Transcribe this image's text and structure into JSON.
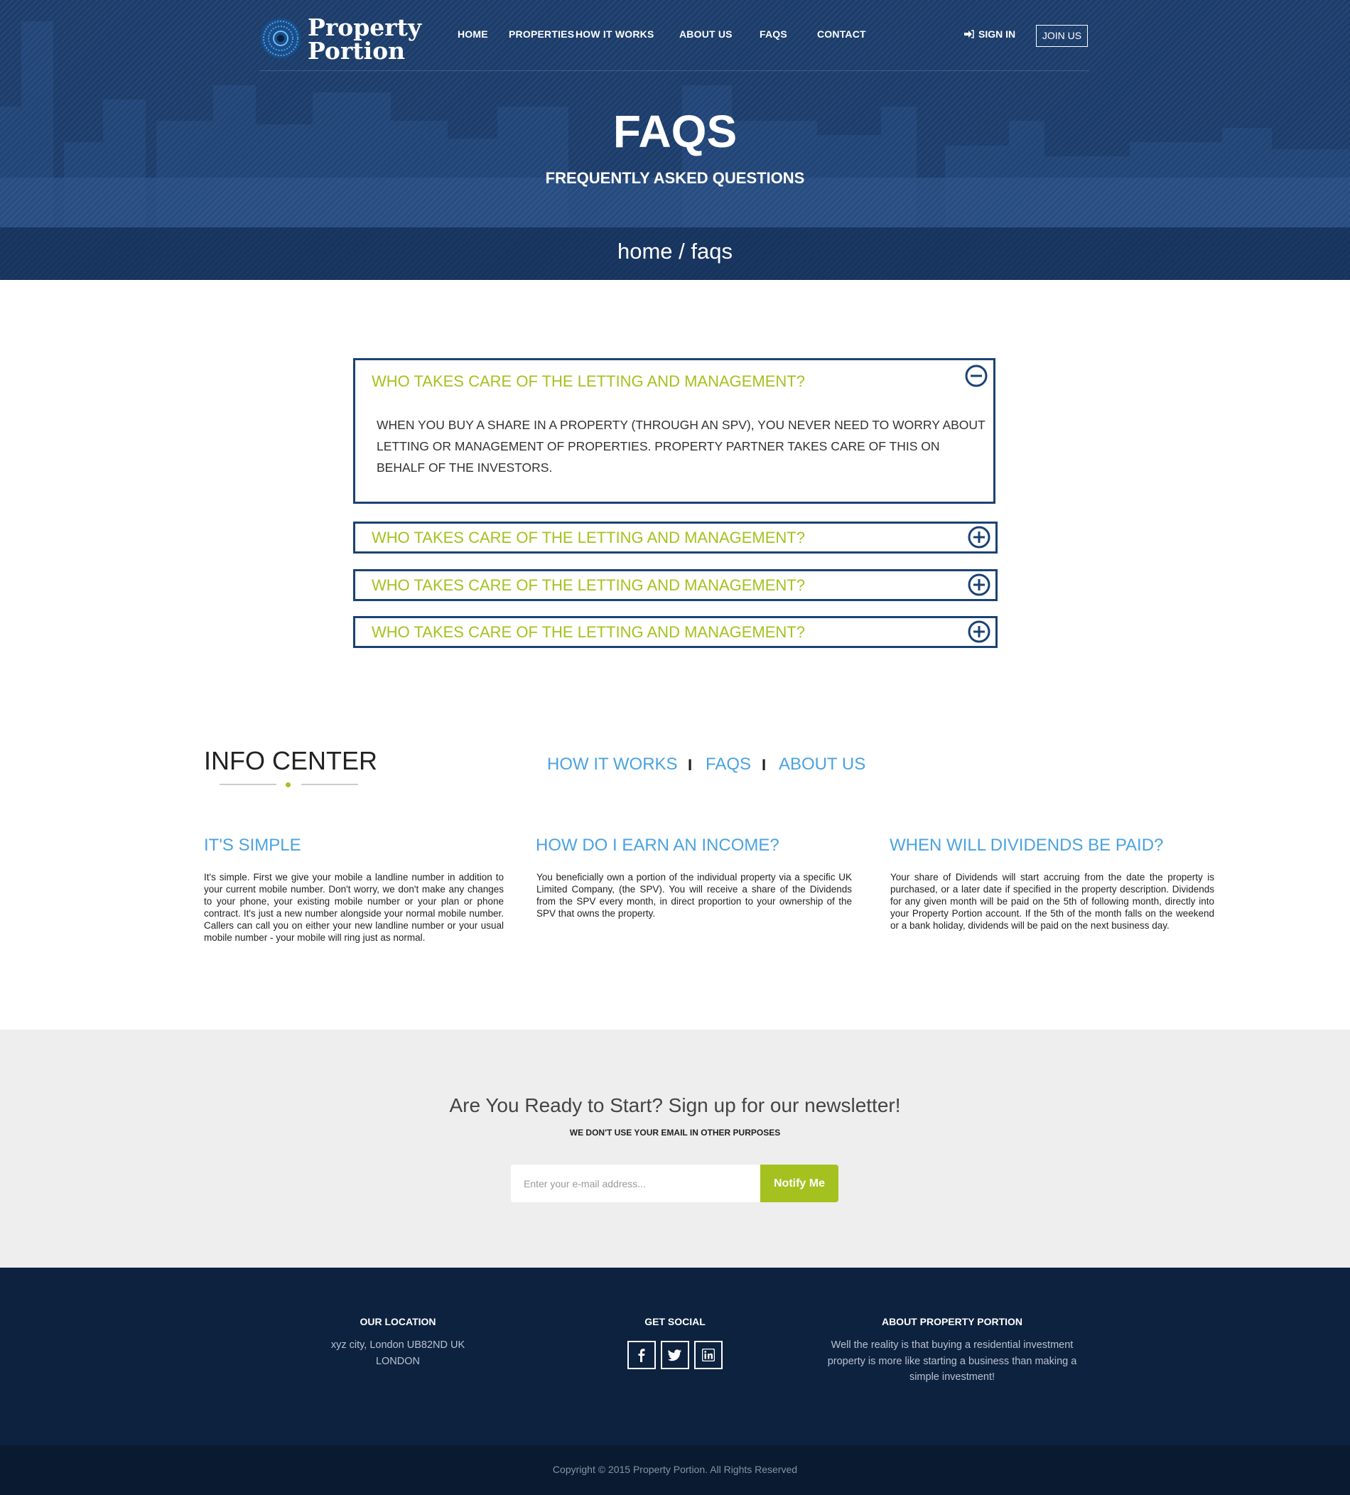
{
  "header": {
    "logo_line1": "Property",
    "logo_line2": "Portion",
    "nav": [
      "HOME",
      "PROPERTIES",
      "HOW IT WORKS",
      "ABOUT US",
      "FAQS",
      "CONTACT"
    ],
    "signin": "SIGN IN",
    "joinus": "JOIN US"
  },
  "hero": {
    "title": "FAQS",
    "subtitle": "FREQUENTLY ASKED QUESTIONS",
    "breadcrumb": "home / faqs"
  },
  "faqs": [
    {
      "question": "WHO TAKES CARE OF THE LETTING AND MANAGEMENT?",
      "answer": "WHEN YOU BUY A SHARE IN A PROPERTY (THROUGH AN SPV), YOU NEVER NEED TO WORRY ABOUT LETTING OR MANAGEMENT OF PROPERTIES. PROPERTY PARTNER TAKES CARE OF THIS ON BEHALF OF THE INVESTORS.",
      "expanded": true
    },
    {
      "question": "WHO TAKES CARE OF THE LETTING AND MANAGEMENT?",
      "expanded": false
    },
    {
      "question": "WHO TAKES CARE OF THE LETTING AND MANAGEMENT?",
      "expanded": false
    },
    {
      "question": "WHO TAKES CARE OF THE LETTING AND MANAGEMENT?",
      "expanded": false
    }
  ],
  "info_center": {
    "title": "INFO CENTER",
    "links": [
      "HOW IT WORKS",
      "FAQS",
      "ABOUT US"
    ],
    "separator": "I",
    "columns": [
      {
        "title": "IT'S SIMPLE",
        "text": "It's simple. First we give your mobile a landline number in addition to your current mobile number. Don't worry, we don't make any changes to your phone, your existing mobile number or your plan or phone contract. It's just a new number alongside your normal mobile number. Callers can call you on either your new landline number or your usual mobile number - your mobile will ring just as normal."
      },
      {
        "title": "HOW DO I EARN AN INCOME?",
        "text": "You beneficially own a portion of the individual property via a specific UK Limited Company, (the SPV). You will receive a share of the Dividends from the SPV every month, in direct proportion to your ownership of the SPV that owns the property."
      },
      {
        "title": "WHEN WILL DIVIDENDS BE PAID?",
        "text": "Your share of Dividends will start accruing from the date the property is purchased, or a later date if specified in the property description. Dividends for any given month will be paid on the 5th of following month, directly into your Property Portion account. If the 5th of the month falls on the weekend or a bank holiday, dividends will be paid on the next business day."
      }
    ]
  },
  "newsletter": {
    "title": "Are You Ready to Start? Sign up for our newsletter!",
    "subtitle": "WE DON'T USE YOUR EMAIL IN OTHER PURPOSES",
    "placeholder": "Enter your e-mail address...",
    "button": "Notify Me"
  },
  "footer": {
    "location_title": "OUR LOCATION",
    "location_line1": "xyz city, London UB82ND UK",
    "location_line2": "LONDON",
    "social_title": "GET SOCIAL",
    "social_icons": [
      "facebook-icon",
      "twitter-icon",
      "linkedin-icon"
    ],
    "about_title": "ABOUT PROPERTY PORTION",
    "about_text": "Well the reality is that buying a residential investment property is more like starting a business than making a simple investment!",
    "copyright": "Copyright © 2015 Property Portion. All Rights Reserved"
  },
  "colors": {
    "navy": "#1b4273",
    "accent_green": "#a4c21f",
    "link_blue": "#4aa3df",
    "footer_bg": "#0d223f"
  }
}
